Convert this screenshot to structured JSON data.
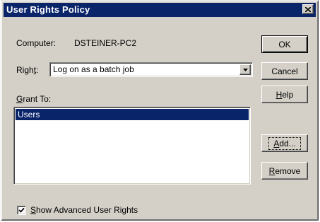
{
  "window": {
    "title": "User Rights Policy",
    "close_glyph": "✕"
  },
  "computer": {
    "label": "Computer:",
    "value": "DSTEINER-PC2"
  },
  "right": {
    "label_prefix": "Righ",
    "label_mnemonic": "t",
    "label_suffix": ":",
    "selected": "Log on as a batch job"
  },
  "grant_to": {
    "label_mnemonic": "G",
    "label_rest": "rant To:",
    "items": [
      "Users"
    ],
    "selected_index": 0
  },
  "buttons": {
    "ok": "OK",
    "cancel": "Cancel",
    "help_mnemonic": "H",
    "help_rest": "elp",
    "add_mnemonic": "A",
    "add_rest": "dd...",
    "remove_mnemonic": "R",
    "remove_rest": "emove"
  },
  "advanced": {
    "checked": true,
    "label_mnemonic": "S",
    "label_rest": "how Advanced User Rights"
  },
  "colors": {
    "titlebar": "#0a246a",
    "face": "#d4d0c8",
    "selection": "#0a246a"
  }
}
